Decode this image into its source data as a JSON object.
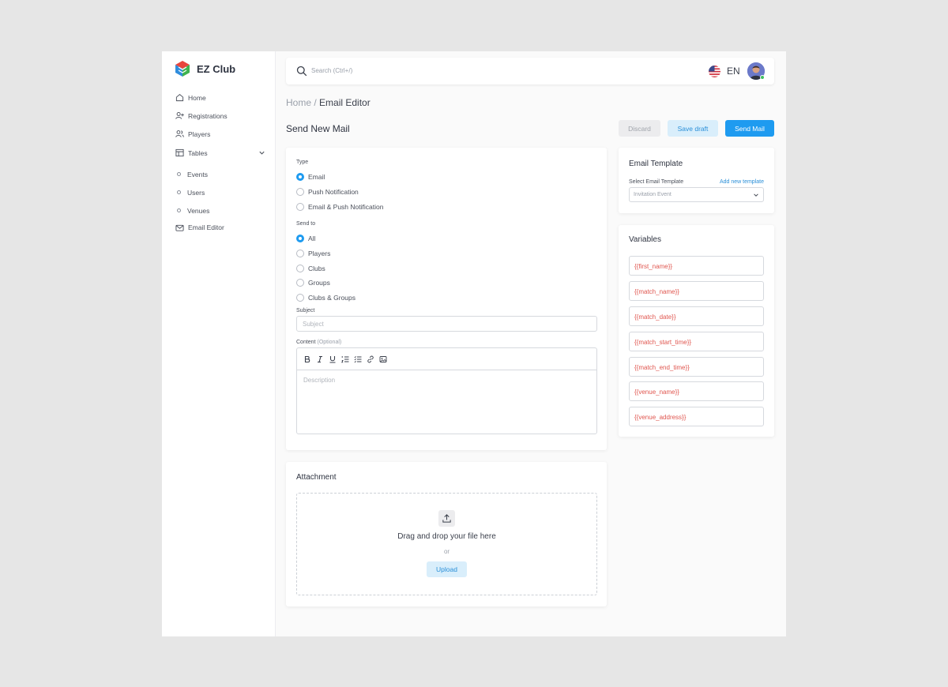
{
  "brand": {
    "name": "EZ Club"
  },
  "sidebar": {
    "items": [
      {
        "label": "Home",
        "icon": "home-icon"
      },
      {
        "label": "Registrations",
        "icon": "user-plus-icon"
      },
      {
        "label": "Players",
        "icon": "users-icon"
      },
      {
        "label": "Tables",
        "icon": "table-icon"
      }
    ],
    "sub_items": [
      "Events",
      "Users",
      "Venues"
    ],
    "email_editor": {
      "label": "Email Editor",
      "icon": "mail-icon"
    }
  },
  "topbar": {
    "search_placeholder": "Search (Ctrl+/)",
    "language": "EN"
  },
  "breadcrumb": {
    "root": "Home",
    "separator": " / ",
    "current": "Email Editor"
  },
  "page": {
    "title": "Send New Mail"
  },
  "actions": {
    "discard": "Discard",
    "save_draft": "Save draft",
    "send_mail": "Send Mail"
  },
  "form": {
    "type_label": "Type",
    "type_options": [
      "Email",
      "Push Notification",
      "Email & Push Notification"
    ],
    "type_selected": 0,
    "send_to_label": "Send to",
    "send_to_options": [
      "All",
      "Players",
      "Clubs",
      "Groups",
      "Clubs & Groups"
    ],
    "send_to_selected": 0,
    "subject_label": "Subject",
    "subject_placeholder": "Subject",
    "content_label": "Content",
    "content_optional": "(Optional)",
    "content_placeholder": "Description",
    "toolbar_icons": [
      "bold-icon",
      "italic-icon",
      "underline-icon",
      "ordered-list-icon",
      "bullet-list-icon",
      "link-icon",
      "image-icon"
    ]
  },
  "attachment": {
    "title": "Attachment",
    "drop_text": "Drag and drop your file here",
    "or_text": "or",
    "upload_label": "Upload"
  },
  "template": {
    "title": "Email Template",
    "select_label": "Select Email Template",
    "add_link": "Add new template",
    "selected": "Invitation Event"
  },
  "variables": {
    "title": "Variables",
    "items": [
      "{{first_name}}",
      "{{match_name}}",
      "{{match_date}}",
      "{{match_start_time}}",
      "{{match_end_time}}",
      "{{venue_name}}",
      "{{venue_address}}"
    ]
  },
  "colors": {
    "accent": "#1e9bf0",
    "variable_text": "#e0564f",
    "background": "#e6e6e6"
  }
}
